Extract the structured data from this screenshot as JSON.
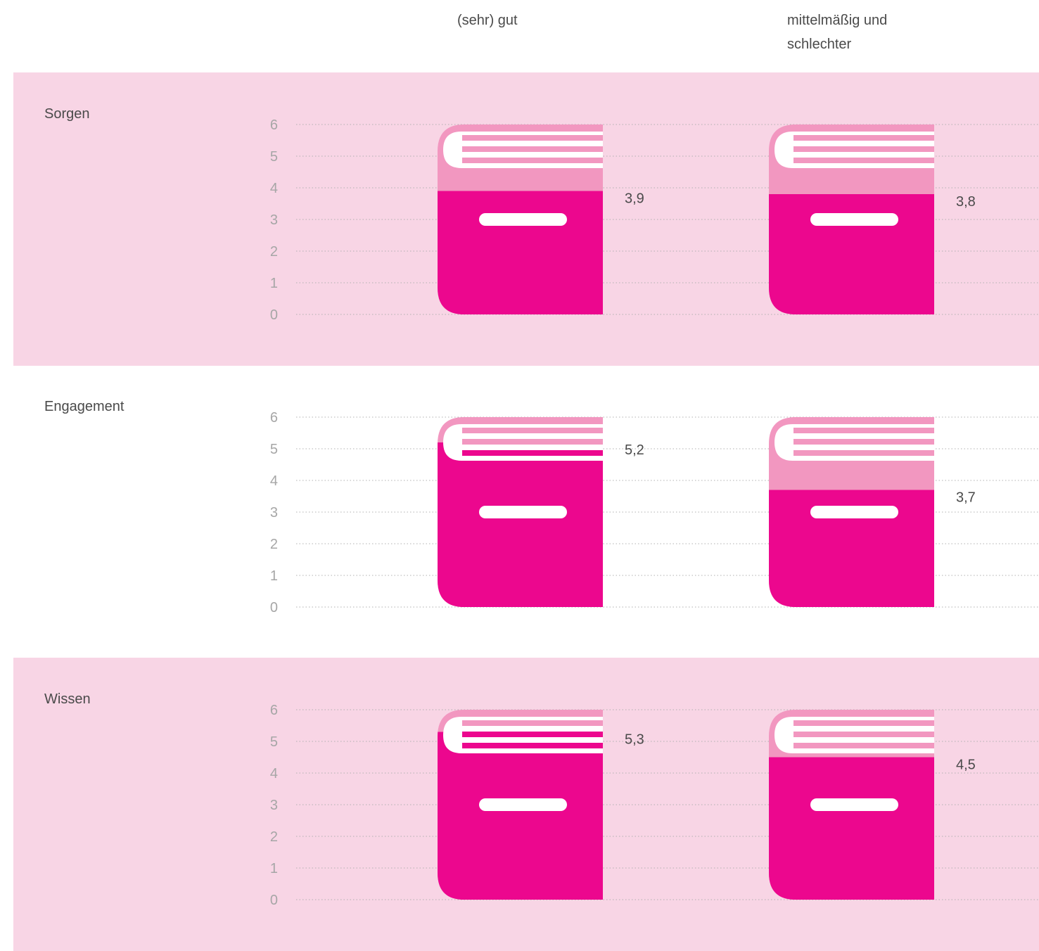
{
  "column_headers": [
    "(sehr) gut",
    "mittelmäßig und\nschlechter"
  ],
  "colors": {
    "panel_bg": "#f8d5e5",
    "book_dark": "#ec078e",
    "book_light": "#f297c0",
    "grid": "#b0b0b0",
    "tick_text": "#a6a6a6"
  },
  "chart_data": [
    {
      "type": "bar",
      "title": "Sorgen",
      "categories": [
        "(sehr) gut",
        "mittelmäßig und schlechter"
      ],
      "values": [
        3.9,
        3.8
      ],
      "value_labels": [
        "3,9",
        "3,8"
      ],
      "ylim": [
        0,
        6
      ],
      "yticks": [
        "0",
        "1",
        "2",
        "3",
        "4",
        "5",
        "6"
      ],
      "grid": true,
      "panel_shaded": true
    },
    {
      "type": "bar",
      "title": "Engagement",
      "categories": [
        "(sehr) gut",
        "mittelmäßig und schlechter"
      ],
      "values": [
        5.2,
        3.7
      ],
      "value_labels": [
        "5,2",
        "3,7"
      ],
      "ylim": [
        0,
        6
      ],
      "yticks": [
        "0",
        "1",
        "2",
        "3",
        "4",
        "5",
        "6"
      ],
      "grid": true,
      "panel_shaded": false
    },
    {
      "type": "bar",
      "title": "Wissen",
      "categories": [
        "(sehr) gut",
        "mittelmäßig und schlechter"
      ],
      "values": [
        5.3,
        4.5
      ],
      "value_labels": [
        "5,3",
        "4,5"
      ],
      "ylim": [
        0,
        6
      ],
      "yticks": [
        "0",
        "1",
        "2",
        "3",
        "4",
        "5",
        "6"
      ],
      "grid": true,
      "panel_shaded": true
    }
  ]
}
